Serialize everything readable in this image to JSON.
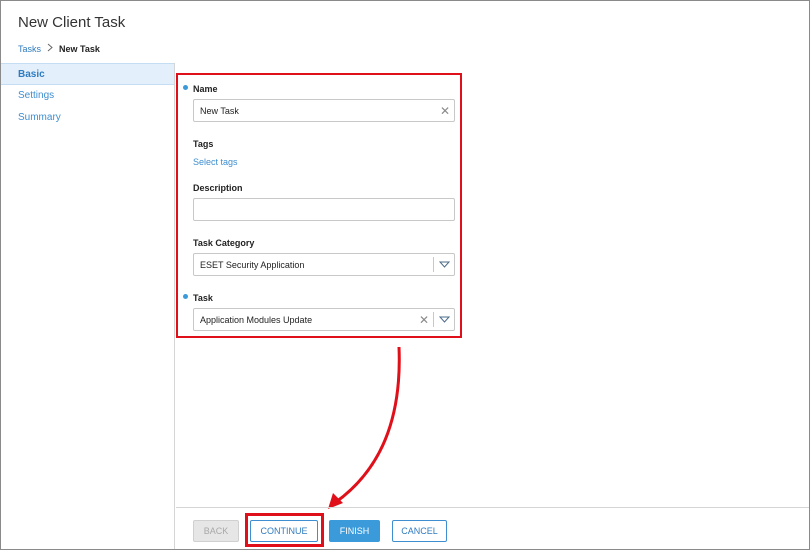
{
  "window": {
    "title": "New Client Task"
  },
  "breadcrumb": {
    "parent": "Tasks",
    "current": "New Task"
  },
  "sidebar": {
    "items": [
      {
        "label": "Basic"
      },
      {
        "label": "Settings"
      },
      {
        "label": "Summary"
      }
    ]
  },
  "form": {
    "name": {
      "label": "Name",
      "value": "New Task"
    },
    "tags": {
      "label": "Tags",
      "link": "Select tags"
    },
    "description": {
      "label": "Description",
      "value": ""
    },
    "task_category": {
      "label": "Task Category",
      "value": "ESET Security Application"
    },
    "task": {
      "label": "Task",
      "value": "Application Modules Update"
    }
  },
  "footer": {
    "back": "BACK",
    "continue": "CONTINUE",
    "finish": "FINISH",
    "cancel": "CANCEL"
  },
  "colors": {
    "accent": "#3b9ad9",
    "highlight": "#e0101a",
    "link": "#2f7bbf"
  }
}
